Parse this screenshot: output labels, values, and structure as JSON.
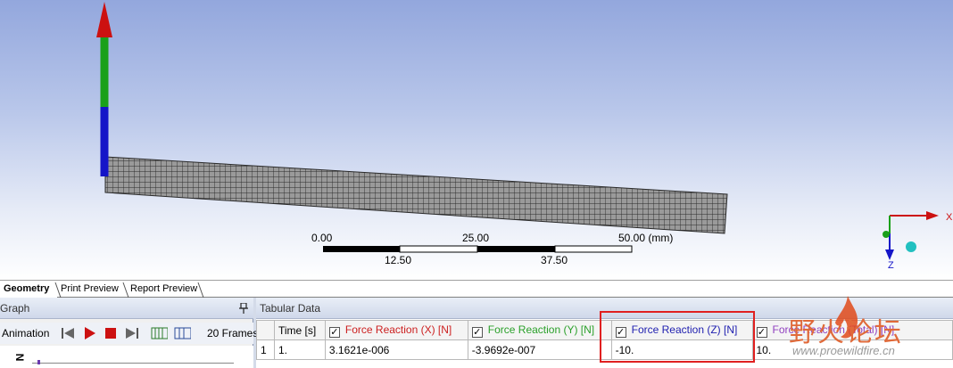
{
  "viewport": {
    "scale": {
      "top_labels": [
        "0.00",
        "25.00",
        "50.00 (mm)"
      ],
      "bottom_labels": [
        "12.50",
        "37.50"
      ]
    },
    "triad": {
      "x_label": "X",
      "z_label": "Z"
    },
    "colors": {
      "x_axis": "#cc1111",
      "y_axis": "#1aa01a",
      "z_axis": "#1515c8",
      "mesh_fill": "#9a9a9a",
      "mesh_line": "#2a2a2a"
    }
  },
  "tabs": [
    {
      "label": "Geometry",
      "active": true
    },
    {
      "label": "Print Preview",
      "active": false
    },
    {
      "label": "Report Preview",
      "active": false
    }
  ],
  "graph_pane": {
    "title": "Graph",
    "pin_icon": "pin-icon",
    "animation_label": "Animation",
    "frames_label": "20 Frames",
    "axis_label": "N"
  },
  "tabular_pane": {
    "title": "Tabular Data",
    "columns": [
      {
        "label": "",
        "color": "#000000"
      },
      {
        "label": "Time [s]",
        "color": "#000000"
      },
      {
        "label": "Force Reaction (X) [N]",
        "color": "#cc2020"
      },
      {
        "label": "Force Reaction (Y) [N]",
        "color": "#2aa02a"
      },
      {
        "label": "Force Reaction (Z) [N]",
        "color": "#2020b0"
      },
      {
        "label": "Force Reaction (Total) [N]",
        "color": "#9040c0"
      }
    ],
    "rows": [
      [
        "1",
        "1.",
        "3.1621e-006",
        "-3.9692e-007",
        "-10.",
        "10."
      ]
    ]
  },
  "watermark": {
    "title": "野火论坛",
    "url": "www.proewildfire.cn"
  }
}
